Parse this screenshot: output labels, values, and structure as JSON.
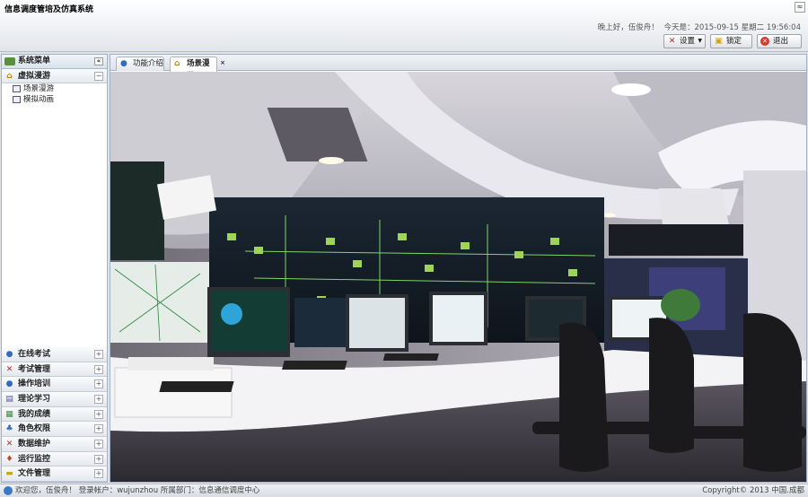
{
  "app": {
    "title": "信息调度管培及仿真系统",
    "collapse_glyph": "≈"
  },
  "header": {
    "greeting": "晚上好，伍俊舟！",
    "today_label": "今天是：2015-09-15 星期二 19:56:04",
    "buttons": {
      "settings": "设置",
      "lock": "锁定",
      "exit": "退出"
    }
  },
  "sidebar": {
    "title": "系统菜单",
    "current_group": {
      "label": "虚拟漫游",
      "toggle": "−"
    },
    "items": [
      {
        "label": "场景漫游"
      },
      {
        "label": "模拟动画"
      }
    ],
    "groups": [
      {
        "label": "在线考试",
        "icon": "user-exam-icon"
      },
      {
        "label": "考试管理",
        "icon": "tools-icon"
      },
      {
        "label": "操作培训",
        "icon": "users-icon"
      },
      {
        "label": "理论学习",
        "icon": "book-icon"
      },
      {
        "label": "我的成绩",
        "icon": "grid-icon"
      },
      {
        "label": "角色权限",
        "icon": "role-icon"
      },
      {
        "label": "数据维护",
        "icon": "wrench-icon"
      },
      {
        "label": "运行监控",
        "icon": "monitor-icon"
      },
      {
        "label": "文件管理",
        "icon": "folder-icon"
      }
    ],
    "expand_glyph": "+"
  },
  "tabs": [
    {
      "label": "功能介绍",
      "icon": "user-icon"
    },
    {
      "label": "场景漫游",
      "icon": "home-icon",
      "active": true,
      "close": "×"
    }
  ],
  "footer": {
    "left": "欢迎您，伍俊舟！ 登录帐户：wujunzhou 所属部门：信息通信调度中心",
    "right": "Copyright© 2013 中国.成都"
  },
  "colors": {
    "accent": "#3b78c4",
    "border": "#9fb2c8"
  }
}
